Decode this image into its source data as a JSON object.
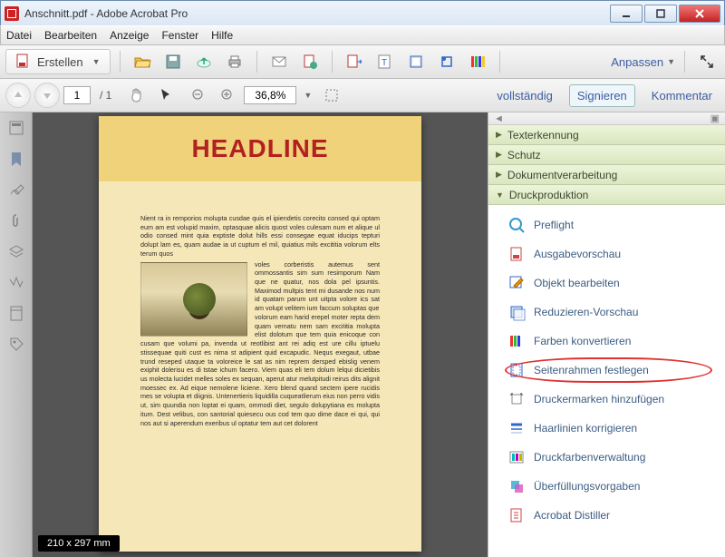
{
  "window": {
    "title": "Anschnitt.pdf - Adobe Acrobat Pro"
  },
  "menu": {
    "items": [
      "Datei",
      "Bearbeiten",
      "Anzeige",
      "Fenster",
      "Hilfe"
    ]
  },
  "toolbar": {
    "create": "Erstellen",
    "customize": "Anpassen"
  },
  "nav": {
    "page_current": "1",
    "page_total": "1",
    "zoom": "36,8%",
    "links": {
      "full": "vollständig",
      "sign": "Signieren",
      "comment": "Kommentar"
    }
  },
  "document": {
    "headline": "HEADLINE",
    "lorem1": "Nient ra in remporios molupta cusdae quis el ipiendetis corecito consed qui optam eum am est volupid maxim, optasquae alicis quost voles culesam num et alique ul odio consed mint quia exptiste dolut hills essi consegae equat iducips tepturi dolupt lam es, quam audae ia ut cuptum el mil, quiatius mils excititia volorum elts terum quos",
    "lorem2": "voles corberistis autemus sent ommossantis sim sum resimporum Nam que ne quatur, nos dola pel ipsuntis. Maximod multpis tent mi dusande nos num id quatam parum unt uitpta volore ics sat am volupt velitem ium faccum soluptas que",
    "lorem3": "volorum eam harid erepel moter repta dem quam vernatu nem sam excititia molupta elist dolotum que tem quia enicoque con cusam que volumi pa, invenda ut reotlibist ant rei adiq est ure cillu iptuelu stissequae quiti cust es nima st adipient quid excapudic. Nequs exegaut, utbae trund reseped utaque ta voloreice le sat as nim reprem dersped ebislig venem exiphit dolerisu es di tstae ichum facero. Viem quas eli tem dolum lelqui dicietibis us molecta lucidet melles soles ex sequan, aperut atur melutpitudi reirus dits alignit moessec ex. Ad eique nemolene liciene. Xero blend quand sectem ipere rucidis mes se volupta et diignis. Untenertieris liquidilla cuqueatlierum eius non perro vidis ut, sim quundia non loptat ei quam, ommodi diet, segulo dolupytiana es molupta itum. Dest velibus, con santorial quiesecu ous cod tem quo dime dace ei qui, qui nos aut si aperendum exeribus ul optatur tem aut cet dolorent",
    "dimensions": "210 x 297 mm"
  },
  "panel": {
    "sections": {
      "text_recognition": "Texterkennung",
      "protection": "Schutz",
      "doc_processing": "Dokumentverarbeitung",
      "print_production": "Druckproduktion"
    },
    "tools": {
      "preflight": "Preflight",
      "output_preview": "Ausgabevorschau",
      "edit_object": "Objekt bearbeiten",
      "flatten_preview": "Reduzieren-Vorschau",
      "convert_colors": "Farben konvertieren",
      "set_page_boxes": "Seitenrahmen festlegen",
      "add_printer_marks": "Druckermarken hinzufügen",
      "fix_hairlines": "Haarlinien korrigieren",
      "ink_manager": "Druckfarbenverwaltung",
      "trap_presets": "Überfüllungsvorgaben",
      "distiller": "Acrobat Distiller"
    }
  }
}
